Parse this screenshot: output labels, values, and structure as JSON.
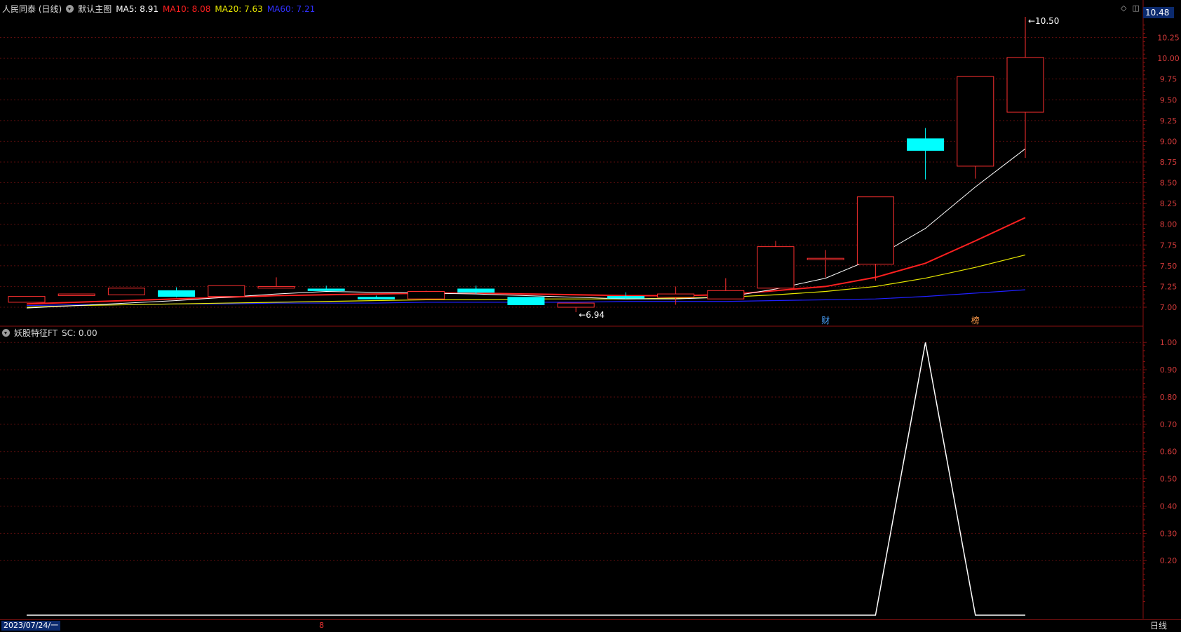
{
  "header": {
    "stock_name": "人民同泰 (日线)",
    "main_chart_label": "默认主图",
    "ma": [
      {
        "label": "MA5: 8.91",
        "color": "#ffffff"
      },
      {
        "label": "MA10: 8.08",
        "color": "#ff2020"
      },
      {
        "label": "MA20: 7.63",
        "color": "#e8e800"
      },
      {
        "label": "MA60: 7.21",
        "color": "#2020ff"
      }
    ]
  },
  "indicator_header": {
    "label": "妖股特征FT",
    "value_text": "SC: 0.00"
  },
  "price_badge": "10.48",
  "bottom": {
    "date": "2023/07/24/一",
    "month_marker": "8",
    "period": "日线"
  },
  "chart_data": [
    {
      "type": "candlestick",
      "ylim": [
        6.85,
        10.55
      ],
      "yticks": [
        "7.00",
        "7.25",
        "7.50",
        "7.75",
        "8.00",
        "8.25",
        "8.50",
        "8.75",
        "9.00",
        "9.25",
        "9.50",
        "9.75",
        "10.00",
        "10.25",
        "10.48"
      ],
      "ohlc": [
        [
          7.06,
          7.13,
          7.06,
          7.13
        ],
        [
          7.14,
          7.16,
          7.14,
          7.16
        ],
        [
          7.15,
          7.23,
          7.15,
          7.23
        ],
        [
          7.2,
          7.24,
          7.12,
          7.13
        ],
        [
          7.13,
          7.26,
          7.13,
          7.26
        ],
        [
          7.23,
          7.36,
          7.23,
          7.25
        ],
        [
          7.22,
          7.26,
          7.2,
          7.2
        ],
        [
          7.12,
          7.14,
          7.1,
          7.1
        ],
        [
          7.1,
          7.2,
          7.1,
          7.19
        ],
        [
          7.22,
          7.26,
          7.16,
          7.18
        ],
        [
          7.12,
          7.12,
          7.03,
          7.03
        ],
        [
          7.0,
          7.04,
          6.94,
          7.05
        ],
        [
          7.13,
          7.18,
          7.1,
          7.11
        ],
        [
          7.12,
          7.25,
          7.03,
          7.16
        ],
        [
          7.1,
          7.35,
          7.1,
          7.2
        ],
        [
          7.23,
          7.8,
          7.23,
          7.73
        ],
        [
          7.59,
          7.69,
          7.36,
          7.59
        ],
        [
          7.52,
          8.33,
          7.32,
          8.33
        ],
        [
          9.03,
          9.16,
          8.54,
          8.89
        ],
        [
          8.7,
          9.78,
          8.55,
          9.78
        ],
        [
          9.35,
          10.5,
          8.8,
          10.01
        ]
      ],
      "ma": {
        "MA5": [
          6.99,
          7.02,
          7.05,
          7.08,
          7.12,
          7.16,
          7.19,
          7.18,
          7.17,
          7.16,
          7.14,
          7.12,
          7.1,
          7.1,
          7.12,
          7.22,
          7.35,
          7.6,
          7.95,
          8.45,
          8.91
        ],
        "MA10": [
          7.04,
          7.06,
          7.08,
          7.1,
          7.12,
          7.14,
          7.15,
          7.16,
          7.17,
          7.17,
          7.16,
          7.15,
          7.14,
          7.14,
          7.15,
          7.2,
          7.25,
          7.36,
          7.53,
          7.8,
          8.08
        ],
        "MA20": [
          7.0,
          7.02,
          7.03,
          7.04,
          7.05,
          7.06,
          7.07,
          7.08,
          7.09,
          7.09,
          7.1,
          7.1,
          7.1,
          7.11,
          7.12,
          7.15,
          7.19,
          7.25,
          7.35,
          7.48,
          7.63
        ],
        "MA60": [
          7.02,
          7.03,
          7.03,
          7.04,
          7.04,
          7.05,
          7.05,
          7.05,
          7.06,
          7.06,
          7.06,
          7.06,
          7.07,
          7.07,
          7.07,
          7.08,
          7.09,
          7.1,
          7.13,
          7.17,
          7.21
        ]
      },
      "annotations": [
        {
          "text": "10.50",
          "index": 20,
          "value": 10.5,
          "color": "#ffffff"
        },
        {
          "text": "6.94",
          "index": 11,
          "value": 6.94,
          "color": "#ffffff"
        }
      ],
      "event_markers": [
        {
          "text": "财",
          "index": 16,
          "color": "#4aa3ff"
        },
        {
          "text": "榜",
          "index": 19,
          "color": "#ff9a4a"
        }
      ],
      "colors": {
        "up": "#ff3030",
        "down": "#00ffff"
      }
    },
    {
      "type": "line",
      "ylim": [
        0,
        1.05
      ],
      "yticks": [
        "0.20",
        "0.30",
        "0.40",
        "0.50",
        "0.60",
        "0.70",
        "0.80",
        "0.90",
        "1.00"
      ],
      "values": [
        0,
        0,
        0,
        0,
        0,
        0,
        0,
        0,
        0,
        0,
        0,
        0,
        0,
        0,
        0,
        0,
        0,
        0,
        1,
        0,
        0
      ],
      "color": "#ffffff"
    }
  ]
}
